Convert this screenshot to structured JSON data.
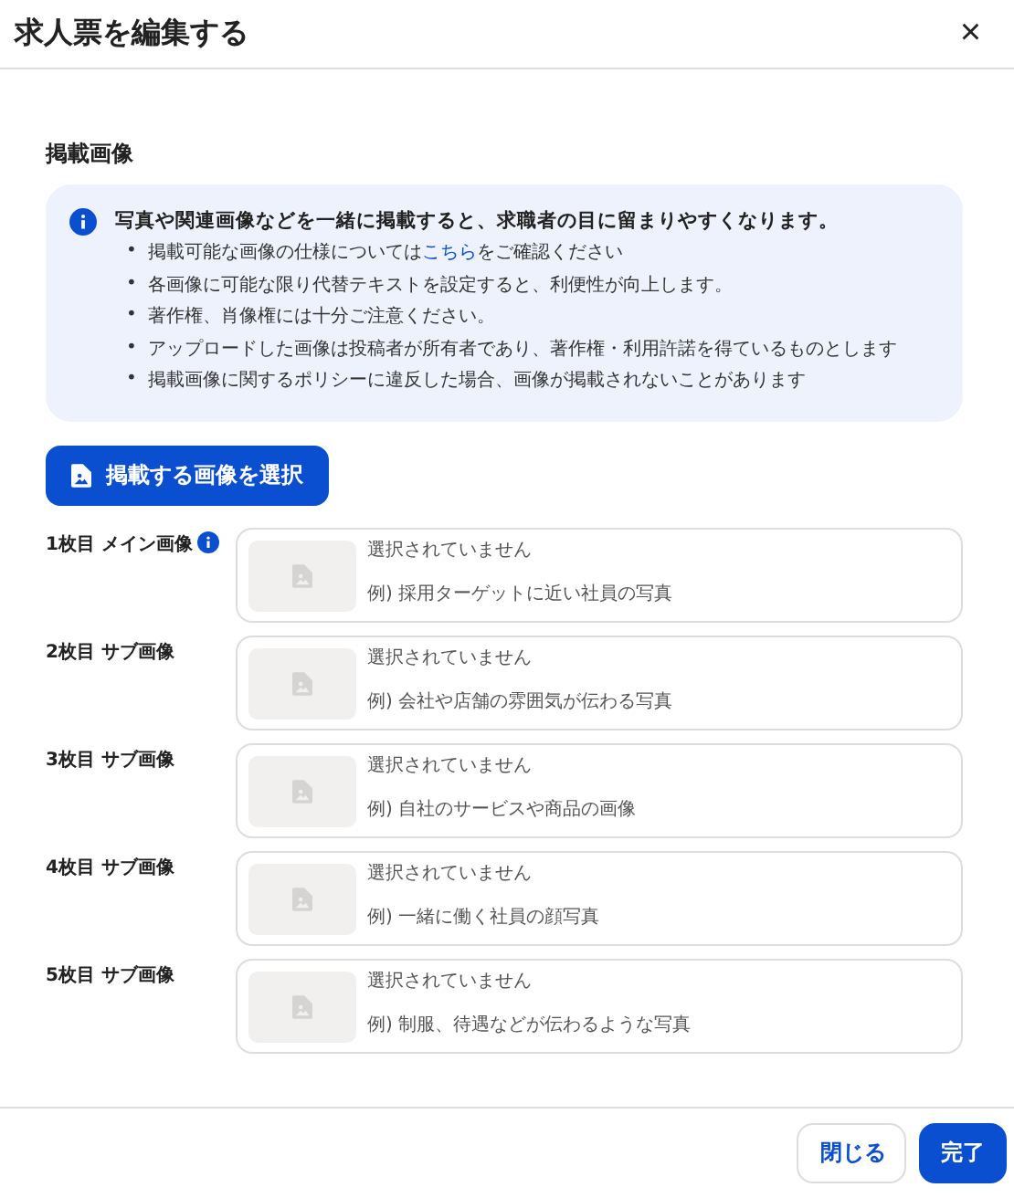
{
  "dialog": {
    "title": "求人票を編集する",
    "close": "×"
  },
  "section_title": "掲載画像",
  "info": {
    "heading": "写真や関連画像などを一緒に掲載すると、求職者の目に留まりやすくなります。",
    "marker": "•",
    "bullets": [
      {
        "text": "掲載可能な画像の仕様については",
        "link": "こちら",
        "after": "をご確認ください"
      },
      {
        "text": "各画像に可能な限り代替テキストを設定すると、利便性が向上します。"
      },
      {
        "text": "著作権、肖像権には十分ご注意ください。"
      },
      {
        "text": "アップロードした画像は投稿者が所有者であり、著作権・利用許諾を得ているものとします"
      },
      {
        "text": "掲載画像に関するポリシーに違反した場合、画像が掲載されないことがあります"
      }
    ]
  },
  "select_button": "掲載する画像を選択",
  "slots": [
    {
      "label": "1枚目 メイン画像",
      "info": true,
      "status": "選択されていません",
      "hint": "例) 採用ターゲットに近い社員の写真"
    },
    {
      "label": "2枚目 サブ画像",
      "info": false,
      "status": "選択されていません",
      "hint": "例) 会社や店舗の雰囲気が伝わる写真"
    },
    {
      "label": "3枚目 サブ画像",
      "info": false,
      "status": "選択されていません",
      "hint": "例) 自社のサービスや商品の画像"
    },
    {
      "label": "4枚目 サブ画像",
      "info": false,
      "status": "選択されていません",
      "hint": "例) 一緒に働く社員の顔写真"
    },
    {
      "label": "5枚目 サブ画像",
      "info": false,
      "status": "選択されていません",
      "hint": "例) 制服、待遇などが伝わるような写真"
    }
  ],
  "footer": {
    "close_button": "閉じる",
    "done_button": "完了"
  }
}
